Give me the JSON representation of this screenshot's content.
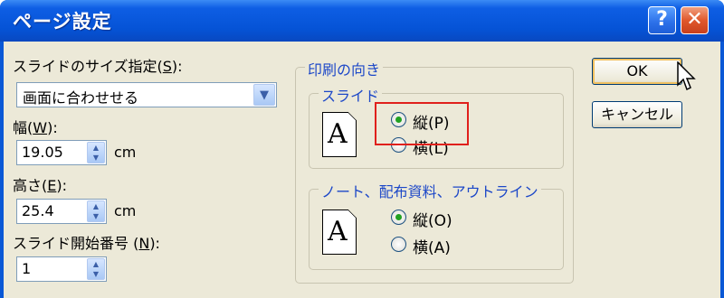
{
  "window": {
    "title": "ページ設定",
    "help_glyph": "?",
    "close_glyph": "✕"
  },
  "slide_size": {
    "label": "スライドのサイズ指定(",
    "key": "S",
    "label_end": "):",
    "value": "画面に合わせせる"
  },
  "width": {
    "label": "幅(",
    "key": "W",
    "label_end": "):",
    "value": "19.05",
    "unit": "cm"
  },
  "height": {
    "label": "高さ(",
    "key": "E",
    "label_end": "):",
    "value": "25.4",
    "unit": "cm"
  },
  "start_number": {
    "label": "スライド開始番号 (",
    "key": "N",
    "label_end": "):",
    "value": "1"
  },
  "orientation": {
    "group_title": "印刷の向き",
    "slides": {
      "title": "スライド",
      "portrait_label": "縦(P)",
      "landscape_label": "横(L)",
      "selected": "portrait"
    },
    "notes": {
      "title": "ノート、配布資料、アウトライン",
      "portrait_label": "縦(O)",
      "landscape_label": "横(A)",
      "selected": "portrait"
    },
    "page_glyph": "A"
  },
  "buttons": {
    "ok": "OK",
    "cancel": "キャンセル"
  },
  "colors": {
    "titlebar": "#0553d6",
    "group_title": "#1d48c8",
    "radio_selected": "#21a121",
    "highlight": "#e0201c"
  }
}
